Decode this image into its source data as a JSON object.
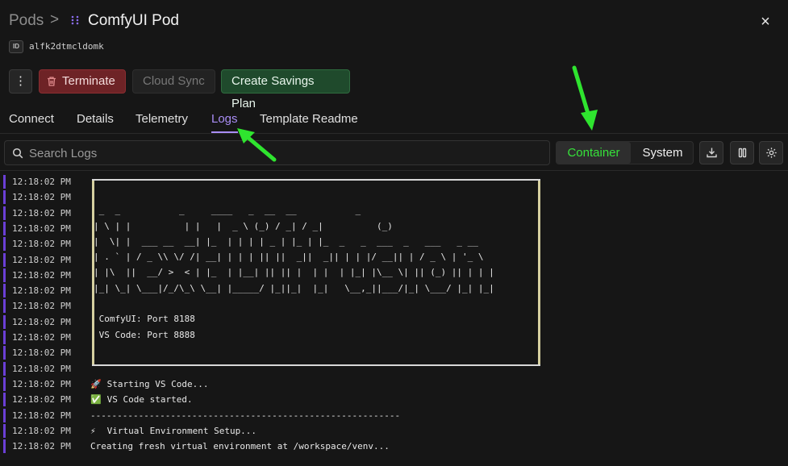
{
  "header": {
    "breadcrumb_root": "Pods",
    "breadcrumb_sep": ">",
    "pod_title": "ComfyUI Pod",
    "pod_id_label": "ID",
    "pod_id": "alfk2dtmcldomk",
    "close_label": "×"
  },
  "actions": {
    "more_label": "⋮",
    "terminate_label": "Terminate",
    "cloud_sync_label": "Cloud Sync",
    "savings_label": "Create Savings Plan"
  },
  "tabs": [
    {
      "label": "Connect"
    },
    {
      "label": "Details"
    },
    {
      "label": "Telemetry"
    },
    {
      "label": "Logs",
      "active": true
    },
    {
      "label": "Template Readme"
    }
  ],
  "logs_toolbar": {
    "search_placeholder": "Search Logs",
    "source_container": "Container",
    "source_system": "System",
    "active_source": "Container"
  },
  "banner": {
    "ascii": [
      "",
      " _  _           _     ____   _  __  __           _",
      "| \\ | |          | |   |  _ \\ (_) / _| / _|          (_)",
      "|  \\| |  ___ __  __| |_  | | | | _ | |_ | |_  _   _  ___  _   ___   _ __",
      "| . ` | / _ \\\\ \\/ /| __| | | | || ||  _||  _|| | | |/ __|| | / _ \\ | '_ \\",
      "| |\\  ||  __/ >  < | |_  | |__| || || |  | |  | |_| |\\__ \\| || (_) || | | |",
      "|_| \\_| \\___|/_/\\_\\ \\__| |_____/ |_||_|  |_|   \\__,_||___/|_| \\___/ |_| |_|",
      "",
      " ComfyUI: Port 8188",
      " VS Code: Port 8888",
      ""
    ]
  },
  "log_entries": [
    {
      "time": "12:18:02 PM",
      "msg": ""
    },
    {
      "time": "12:18:02 PM",
      "msg": ""
    },
    {
      "time": "12:18:02 PM",
      "msg": ""
    },
    {
      "time": "12:18:02 PM",
      "msg": ""
    },
    {
      "time": "12:18:02 PM",
      "msg": ""
    },
    {
      "time": "12:18:02 PM",
      "msg": ""
    },
    {
      "time": "12:18:02 PM",
      "msg": ""
    },
    {
      "time": "12:18:02 PM",
      "msg": ""
    },
    {
      "time": "12:18:02 PM",
      "msg": ""
    },
    {
      "time": "12:18:02 PM",
      "msg": ""
    },
    {
      "time": "12:18:02 PM",
      "msg": ""
    },
    {
      "time": "12:18:02 PM",
      "msg": ""
    },
    {
      "time": "12:18:02 PM",
      "msg": ""
    },
    {
      "time": "12:18:02 PM",
      "emoji": "🚀",
      "msg": " Starting VS Code..."
    },
    {
      "time": "12:18:02 PM",
      "emoji": "✅",
      "msg": " VS Code started."
    },
    {
      "time": "12:18:02 PM",
      "msg": "----------------------------------------------------------"
    },
    {
      "time": "12:18:02 PM",
      "emoji": "⚡",
      "msg": " Virtual Environment Setup..."
    },
    {
      "time": "12:18:02 PM",
      "msg": "Creating fresh virtual environment at /workspace/venv..."
    }
  ],
  "colors": {
    "accent_purple": "#a98df5",
    "terminate_red": "#6e2326",
    "savings_green": "#1f4a2c",
    "annotation_green": "#2fe42f",
    "log_bar": "#6b3fd6"
  }
}
